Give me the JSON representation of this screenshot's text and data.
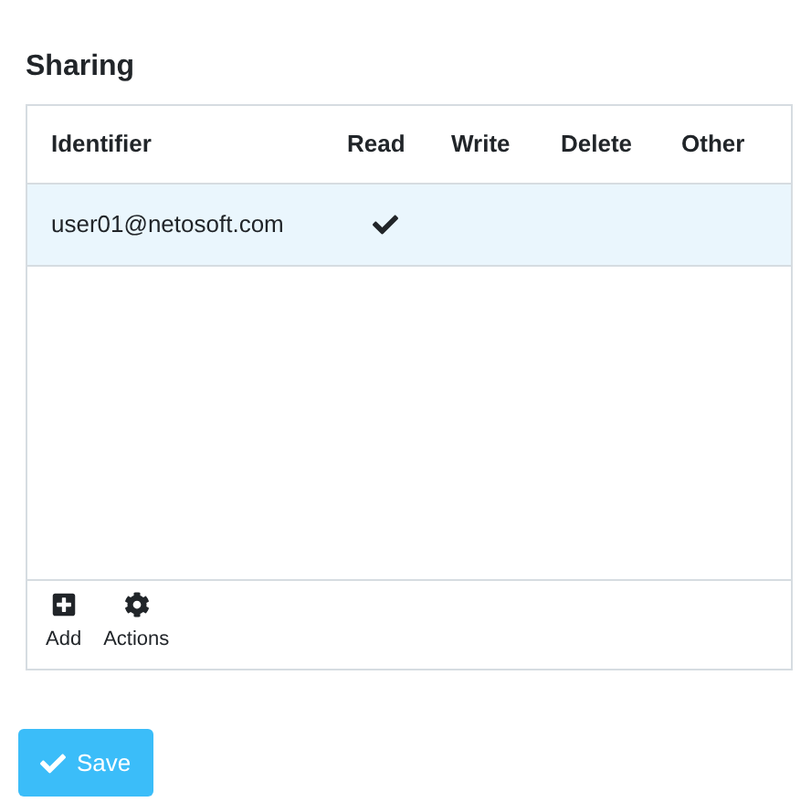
{
  "title": "Sharing",
  "table": {
    "columns": [
      "Identifier",
      "Read",
      "Write",
      "Delete",
      "Other"
    ],
    "rows": [
      {
        "identifier": "user01@netosoft.com",
        "selected": true,
        "read": true,
        "write": false,
        "delete": false,
        "other": false
      }
    ]
  },
  "toolbar": [
    {
      "kind": "add",
      "label": "Add"
    },
    {
      "kind": "actions",
      "label": "Actions"
    }
  ],
  "save_button": {
    "label": "Save"
  }
}
